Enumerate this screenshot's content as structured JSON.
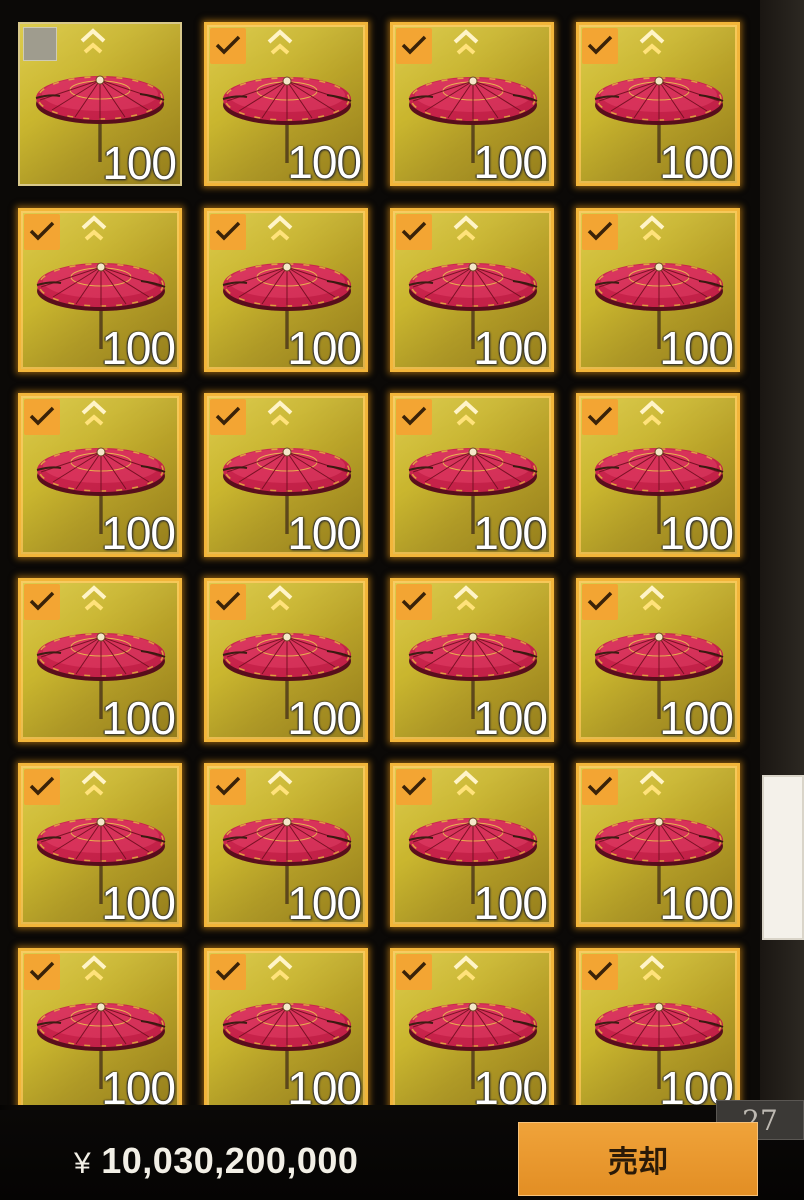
{
  "inventory": {
    "items": [
      {
        "quantity": "100",
        "selected": false
      },
      {
        "quantity": "100",
        "selected": true
      },
      {
        "quantity": "100",
        "selected": true
      },
      {
        "quantity": "100",
        "selected": true
      },
      {
        "quantity": "100",
        "selected": true
      },
      {
        "quantity": "100",
        "selected": true
      },
      {
        "quantity": "100",
        "selected": true
      },
      {
        "quantity": "100",
        "selected": true
      },
      {
        "quantity": "100",
        "selected": true
      },
      {
        "quantity": "100",
        "selected": true
      },
      {
        "quantity": "100",
        "selected": true
      },
      {
        "quantity": "100",
        "selected": true
      },
      {
        "quantity": "100",
        "selected": true
      },
      {
        "quantity": "100",
        "selected": true
      },
      {
        "quantity": "100",
        "selected": true
      },
      {
        "quantity": "100",
        "selected": true
      },
      {
        "quantity": "100",
        "selected": true
      },
      {
        "quantity": "100",
        "selected": true
      },
      {
        "quantity": "100",
        "selected": true
      },
      {
        "quantity": "100",
        "selected": true
      },
      {
        "quantity": "100",
        "selected": true
      },
      {
        "quantity": "100",
        "selected": true
      },
      {
        "quantity": "100",
        "selected": true
      },
      {
        "quantity": "100",
        "selected": true
      }
    ],
    "item_icon": "red-paper-umbrella-icon",
    "rank_icon": "double-chevron-up-icon"
  },
  "footer": {
    "currency_symbol": "¥",
    "money": "10,030,200,000",
    "sell_label": "売却",
    "count": "27"
  },
  "colors": {
    "slot_border": "#f2b53a",
    "check_bg": "#f3a533",
    "sell_button": "#e8982e",
    "umbrella": "#c8224a"
  }
}
